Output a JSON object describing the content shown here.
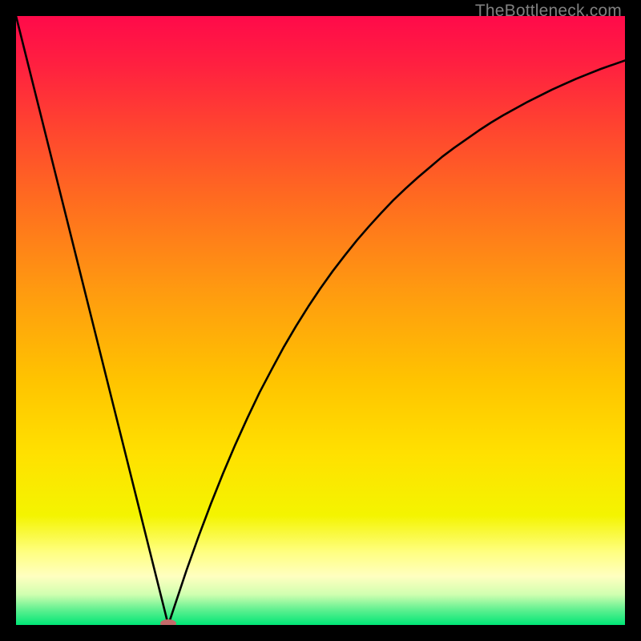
{
  "watermark": "TheBottleneck.com",
  "chart_data": {
    "type": "line",
    "title": "",
    "xlabel": "",
    "ylabel": "",
    "xlim": [
      0,
      100
    ],
    "ylim": [
      0,
      100
    ],
    "curve_minimum_x": 25,
    "marker": {
      "x": 25,
      "y": 0,
      "color": "#c46a6a",
      "rx": 10,
      "ry": 5
    },
    "x": [
      0,
      2,
      4,
      6,
      8,
      10,
      12,
      14,
      16,
      18,
      20,
      22,
      24,
      25,
      26,
      28,
      30,
      32,
      34,
      36,
      38,
      40,
      42,
      44,
      46,
      48,
      50,
      52,
      54,
      56,
      58,
      60,
      62,
      64,
      66,
      68,
      70,
      72,
      74,
      76,
      78,
      80,
      82,
      84,
      86,
      88,
      90,
      92,
      94,
      96,
      98,
      100
    ],
    "values": [
      100,
      92,
      84,
      76,
      68,
      60,
      52,
      44,
      36,
      28,
      20,
      12,
      4,
      0,
      3.0,
      9.0,
      14.6,
      19.9,
      24.9,
      29.6,
      34.0,
      38.2,
      42.0,
      45.7,
      49.1,
      52.3,
      55.3,
      58.1,
      60.7,
      63.2,
      65.5,
      67.7,
      69.8,
      71.7,
      73.5,
      75.2,
      76.9,
      78.4,
      79.8,
      81.2,
      82.5,
      83.7,
      84.8,
      85.9,
      86.9,
      87.9,
      88.8,
      89.7,
      90.5,
      91.3,
      92.0,
      92.7
    ],
    "gradient_stops": [
      {
        "pos": 0.0,
        "color": "#ff0a4a"
      },
      {
        "pos": 0.08,
        "color": "#ff2040"
      },
      {
        "pos": 0.18,
        "color": "#ff4330"
      },
      {
        "pos": 0.3,
        "color": "#ff6b20"
      },
      {
        "pos": 0.45,
        "color": "#ff9a10"
      },
      {
        "pos": 0.6,
        "color": "#ffc400"
      },
      {
        "pos": 0.72,
        "color": "#ffe100"
      },
      {
        "pos": 0.82,
        "color": "#f4f400"
      },
      {
        "pos": 0.88,
        "color": "#ffff80"
      },
      {
        "pos": 0.92,
        "color": "#ffffc0"
      },
      {
        "pos": 0.95,
        "color": "#d0ffb0"
      },
      {
        "pos": 0.975,
        "color": "#60f090"
      },
      {
        "pos": 1.0,
        "color": "#00e676"
      }
    ]
  }
}
